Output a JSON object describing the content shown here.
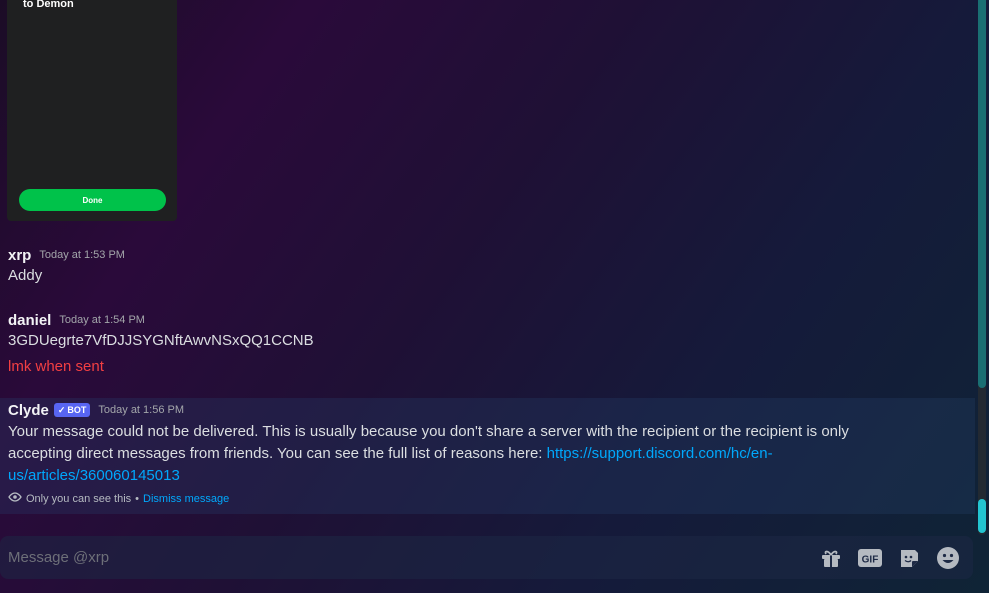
{
  "embed": {
    "text": "to Demon",
    "button_label": "Done"
  },
  "messages": [
    {
      "author": "xrp",
      "timestamp": "Today at 1:53 PM",
      "lines": [
        "Addy"
      ]
    },
    {
      "author": "daniel",
      "timestamp": "Today at 1:54 PM",
      "lines": [
        "3GDUegrte7VfDJJSYGNftAwvNSxQQ1CCNB",
        "lmk when sent"
      ]
    }
  ],
  "clyde": {
    "author": "Clyde",
    "badge": "BOT",
    "timestamp": "Today at 1:56 PM",
    "text": "Your message could not be delivered. This is usually because you don't share a server with the recipient or the recipient is only accepting direct messages from friends. You can see the full list of reasons here: ",
    "link": "https://support.discord.com/hc/en-us/articles/360060145013",
    "ephemeral_note": "Only you can see this",
    "separator": "•",
    "dismiss_label": "Dismiss message"
  },
  "composer": {
    "placeholder": "Message @xrp",
    "icons": [
      "gift-icon",
      "gif-icon",
      "sticker-icon",
      "emoji-icon"
    ]
  },
  "colors": {
    "accent_link": "#00a8fc",
    "done_green": "#00c24a",
    "bot_badge": "#5865f2",
    "error_red": "#f23f42"
  }
}
